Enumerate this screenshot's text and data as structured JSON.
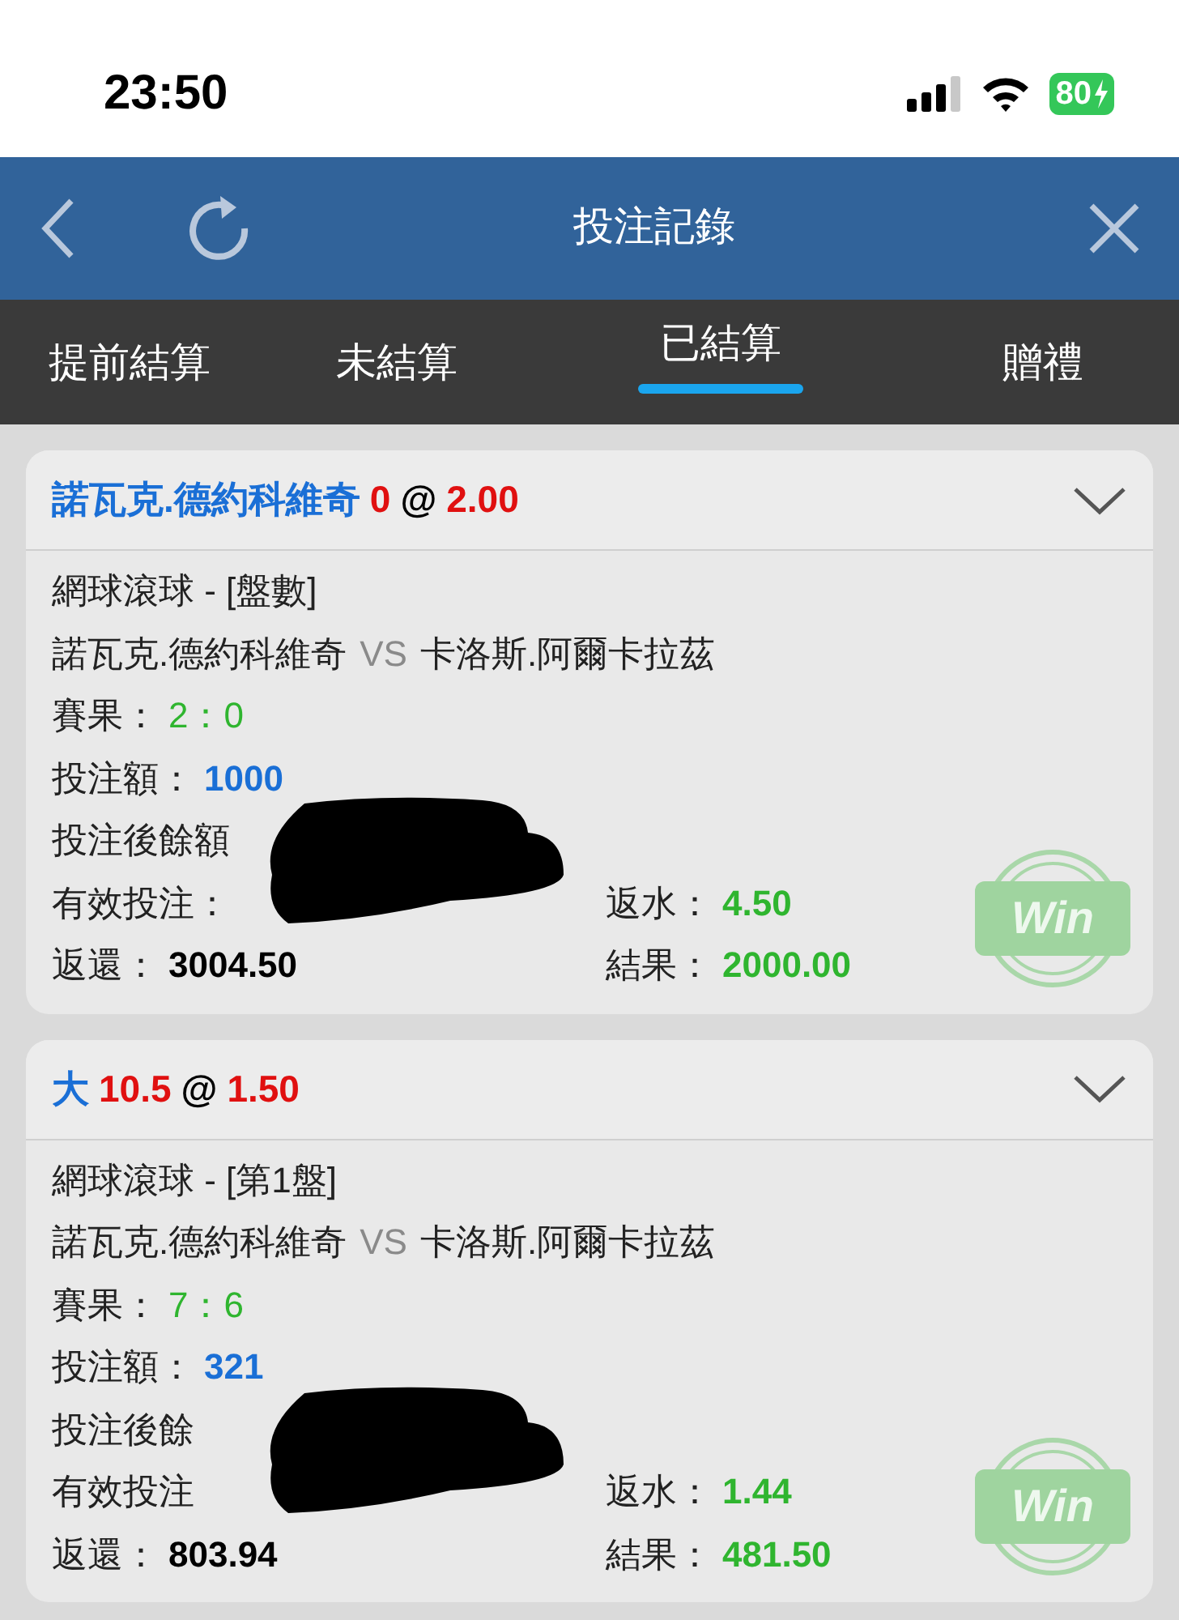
{
  "status_bar": {
    "time": "23:50",
    "battery": "80"
  },
  "header": {
    "title": "投注記錄"
  },
  "tabs": [
    {
      "label": "提前結算",
      "selected": false
    },
    {
      "label": "未結算",
      "selected": false
    },
    {
      "label": "已結算",
      "selected": true
    },
    {
      "label": "贈禮",
      "selected": false
    }
  ],
  "bets": [
    {
      "selection": "諾瓦克.德約科維奇",
      "line": "0",
      "at": "@",
      "odds": "2.00",
      "market": "網球滾球 - [盤數]",
      "home": "諾瓦克.德約科維奇",
      "vs": "VS",
      "away": "卡洛斯.阿爾卡拉茲",
      "score_label": "賽果：",
      "score": "2：0",
      "stake_label": "投注額：",
      "stake": "1000",
      "balance_label": "投注後餘額",
      "valid_label": "有效投注：",
      "rebate_label": "返水：",
      "rebate": "4.50",
      "return_label": "返還：",
      "return": "3004.50",
      "result_label": "結果：",
      "result": "2000.00",
      "stamp": "Win",
      "redacted": true
    },
    {
      "selection": "大",
      "line": "10.5",
      "at": "@",
      "odds": "1.50",
      "market": "網球滾球 - [第1盤]",
      "home": "諾瓦克.德約科維奇",
      "vs": "VS",
      "away": "卡洛斯.阿爾卡拉茲",
      "score_label": "賽果：",
      "score": "7：6",
      "stake_label": "投注額：",
      "stake": "321",
      "balance_label": "投注後餘",
      "valid_label": "有效投注",
      "rebate_label": "返水：",
      "rebate": "1.44",
      "return_label": "返還：",
      "return": "803.94",
      "result_label": "結果：",
      "result": "481.50",
      "stamp": "Win",
      "redacted": true
    }
  ]
}
